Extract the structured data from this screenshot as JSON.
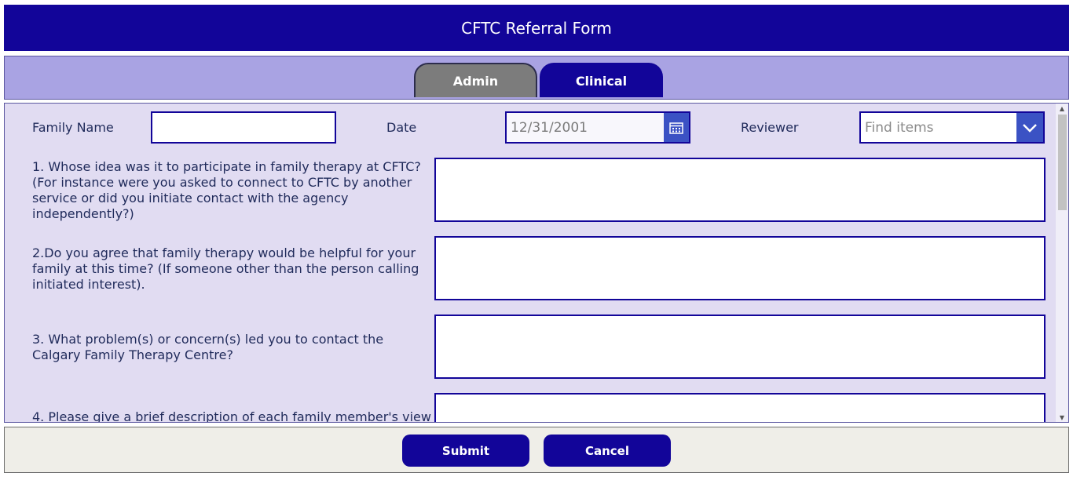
{
  "header": {
    "title": "CFTC Referral Form"
  },
  "tabs": [
    {
      "label": "Admin",
      "active": false
    },
    {
      "label": "Clinical",
      "active": true
    }
  ],
  "form": {
    "family_name_label": "Family Name",
    "family_name_value": "",
    "date_label": "Date",
    "date_value": "12/31/2001",
    "reviewer_label": "Reviewer",
    "reviewer_placeholder": "Find items",
    "questions": [
      "1. Whose idea was it to participate in family therapy at CFTC? (For instance were you asked to connect to CFTC by another service or did you initiate contact with the agency independently?)",
      "2.Do you agree that family therapy would be helpful for your family at this time? (If someone other than the person calling initiated interest).",
      "3. What problem(s) or concern(s) led you to contact the Calgary Family Therapy Centre?",
      "4. Please give a brief description of each family member's view"
    ]
  },
  "footer": {
    "submit_label": "Submit",
    "cancel_label": "Cancel"
  },
  "colors": {
    "primary": "#120599",
    "tabbar": "#a9a3e3",
    "form_bg": "#e1dcf2",
    "accent": "#3b52c4"
  },
  "icons": {
    "calendar": "calendar-icon",
    "dropdown": "chevron-down-icon"
  }
}
